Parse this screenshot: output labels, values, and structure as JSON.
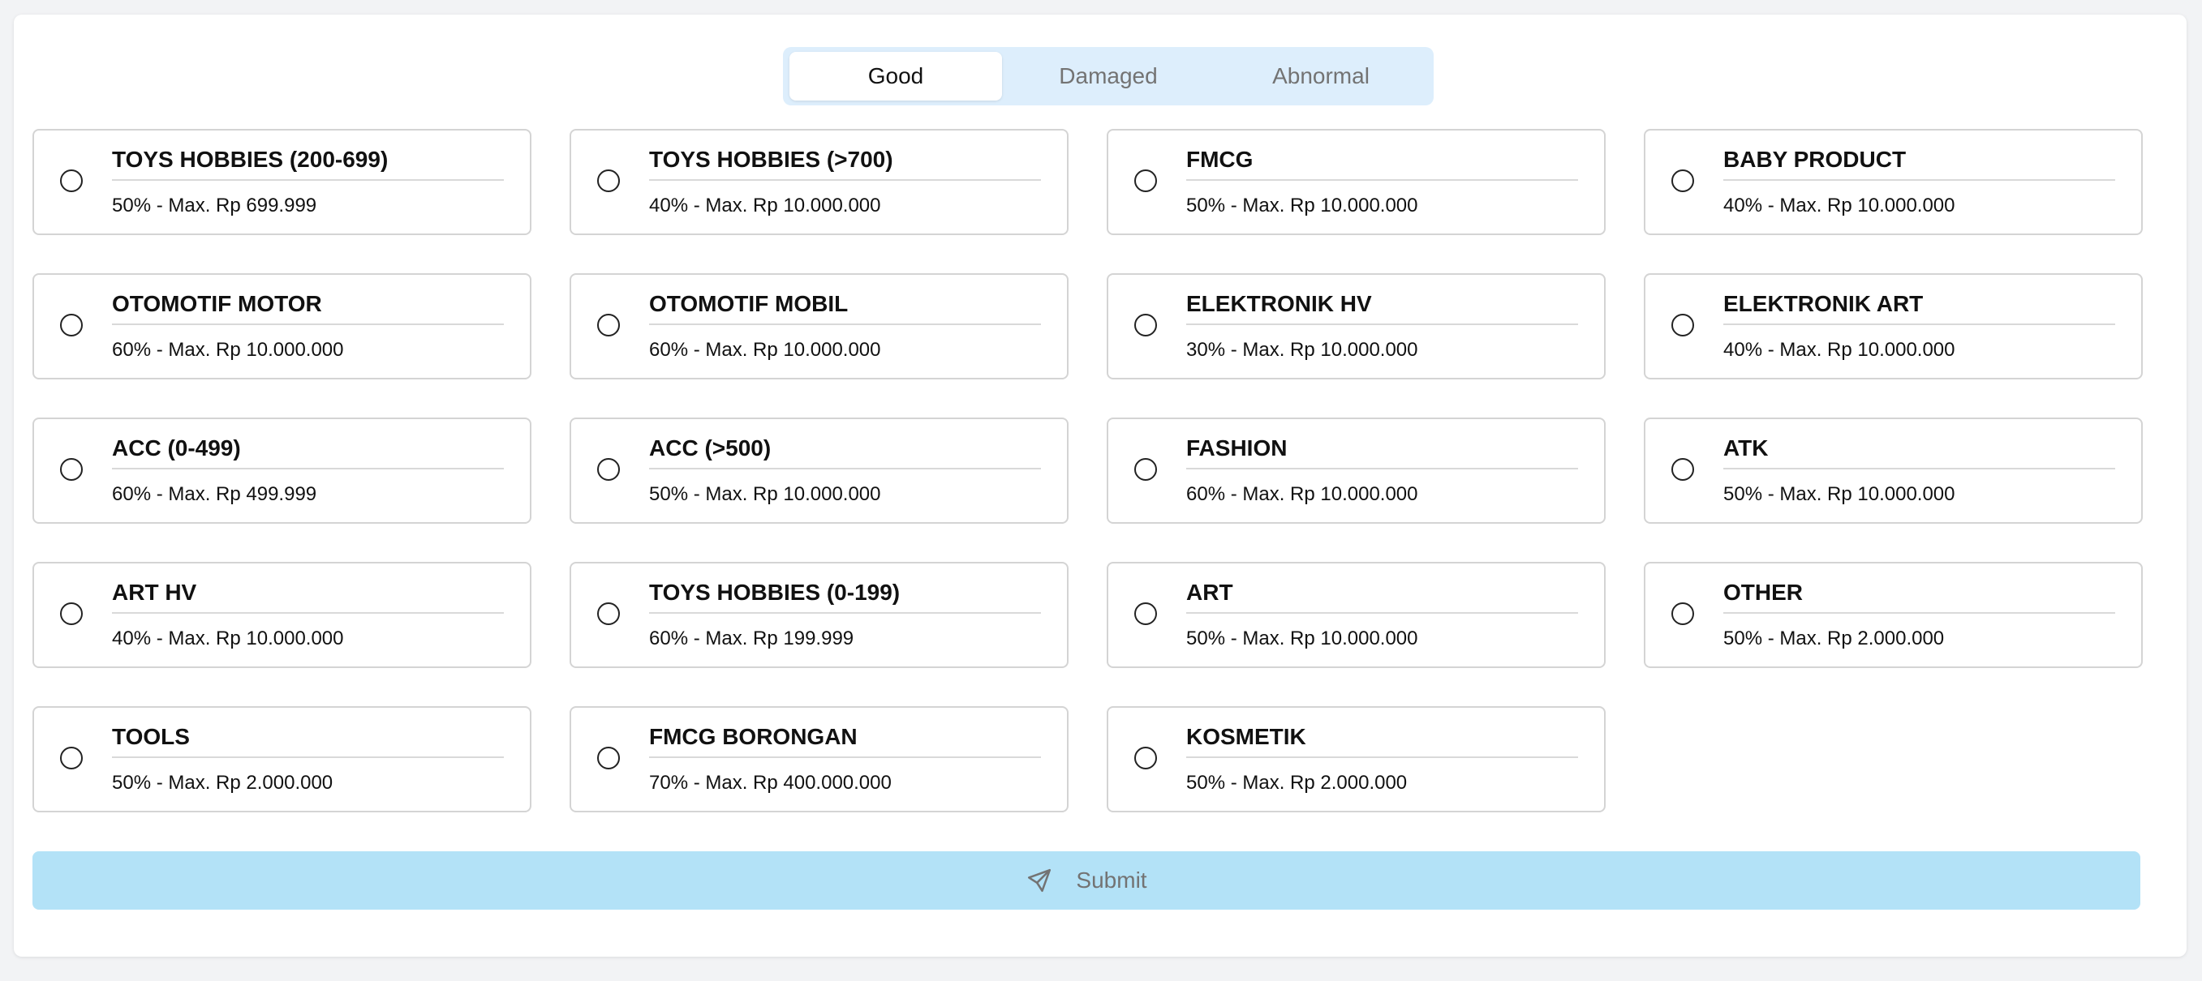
{
  "tabs": [
    {
      "label": "Good",
      "active": true
    },
    {
      "label": "Damaged",
      "active": false
    },
    {
      "label": "Abnormal",
      "active": false
    }
  ],
  "options": [
    {
      "title": "TOYS HOBBIES (200-699)",
      "detail": "50% - Max. Rp 699.999"
    },
    {
      "title": "TOYS HOBBIES (>700)",
      "detail": "40% - Max. Rp 10.000.000"
    },
    {
      "title": "FMCG",
      "detail": "50% - Max. Rp 10.000.000"
    },
    {
      "title": "BABY PRODUCT",
      "detail": "40% - Max. Rp 10.000.000"
    },
    {
      "title": "OTOMOTIF MOTOR",
      "detail": "60% - Max. Rp 10.000.000"
    },
    {
      "title": "OTOMOTIF MOBIL",
      "detail": "60% - Max. Rp 10.000.000"
    },
    {
      "title": "ELEKTRONIK HV",
      "detail": "30% - Max. Rp 10.000.000"
    },
    {
      "title": "ELEKTRONIK ART",
      "detail": "40% - Max. Rp 10.000.000"
    },
    {
      "title": "ACC (0-499)",
      "detail": "60% - Max. Rp 499.999"
    },
    {
      "title": "ACC (>500)",
      "detail": "50% - Max. Rp 10.000.000"
    },
    {
      "title": "FASHION",
      "detail": "60% - Max. Rp 10.000.000"
    },
    {
      "title": "ATK",
      "detail": "50% - Max. Rp 10.000.000"
    },
    {
      "title": "ART HV",
      "detail": "40% - Max. Rp 10.000.000"
    },
    {
      "title": "TOYS HOBBIES (0-199)",
      "detail": "60% - Max. Rp 199.999"
    },
    {
      "title": "ART",
      "detail": "50% - Max. Rp 10.000.000"
    },
    {
      "title": "OTHER",
      "detail": "50% - Max. Rp 2.000.000"
    },
    {
      "title": "TOOLS",
      "detail": "50% - Max. Rp 2.000.000"
    },
    {
      "title": "FMCG BORONGAN",
      "detail": "70% - Max. Rp 400.000.000"
    },
    {
      "title": "KOSMETIK",
      "detail": "50% - Max. Rp 2.000.000"
    }
  ],
  "submit": {
    "label": "Submit",
    "icon": "send-icon"
  },
  "colors": {
    "tab_bar_bg": "#ddeefc",
    "submit_bg": "#b3e2f7",
    "card_border": "#d4d4d4"
  }
}
